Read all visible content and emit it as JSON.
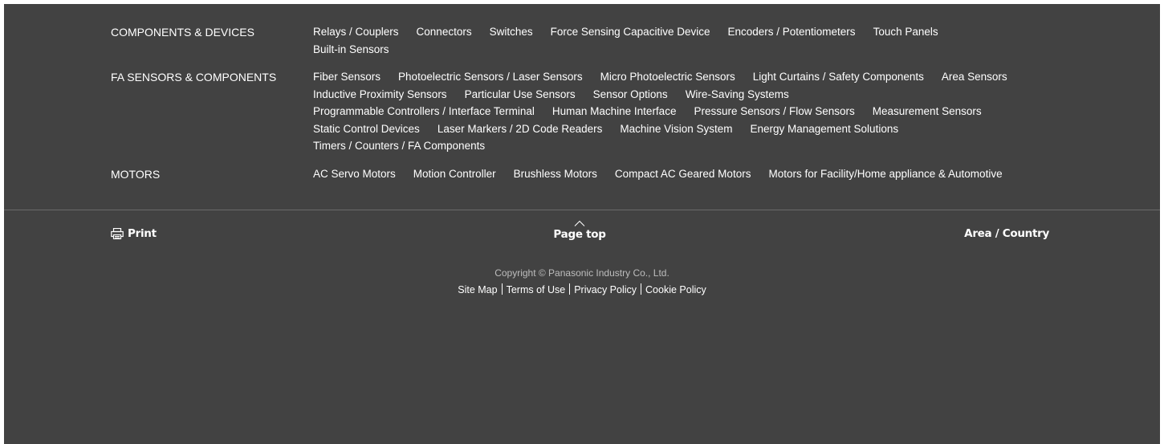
{
  "categories": [
    {
      "title": "COMPONENTS & DEVICES",
      "links": [
        "Relays / Couplers",
        "Connectors",
        "Switches",
        "Force Sensing Capacitive Device",
        "Encoders / Potentiometers",
        "Touch Panels",
        "Built-in Sensors"
      ]
    },
    {
      "title": "FA SENSORS & COMPONENTS",
      "links": [
        "Fiber Sensors",
        "Photoelectric Sensors / Laser Sensors",
        "Micro Photoelectric Sensors",
        "Light Curtains / Safety Components",
        "Area Sensors",
        "Inductive Proximity Sensors",
        "Particular Use Sensors",
        "Sensor Options",
        "Wire-Saving Systems",
        "Programmable Controllers / Interface Terminal",
        "Human Machine Interface",
        "Pressure Sensors / Flow Sensors",
        "Measurement Sensors",
        "Static Control Devices",
        "Laser Markers / 2D Code Readers",
        "Machine Vision System",
        "Energy Management Solutions",
        "Timers / Counters / FA Components"
      ]
    },
    {
      "title": "MOTORS",
      "links": [
        "AC Servo Motors",
        "Motion Controller",
        "Brushless Motors",
        "Compact AC Geared Motors",
        "Motors for Facility/Home appliance & Automotive"
      ]
    }
  ],
  "utility": {
    "print_label": "Print",
    "print_icon": "printer-icon",
    "pagetop_label": "Page top",
    "pagetop_icon": "chevron-up-icon",
    "area_label": "Area / Country"
  },
  "copyright": "Copyright © Panasonic Industry Co., Ltd.",
  "legal_links": [
    "Site Map",
    "Terms of Use",
    "Privacy Policy",
    "Cookie Policy"
  ],
  "colors": {
    "footer_bg": "#424242",
    "text": "#ffffff",
    "copyright_text": "#bdbdbd"
  }
}
